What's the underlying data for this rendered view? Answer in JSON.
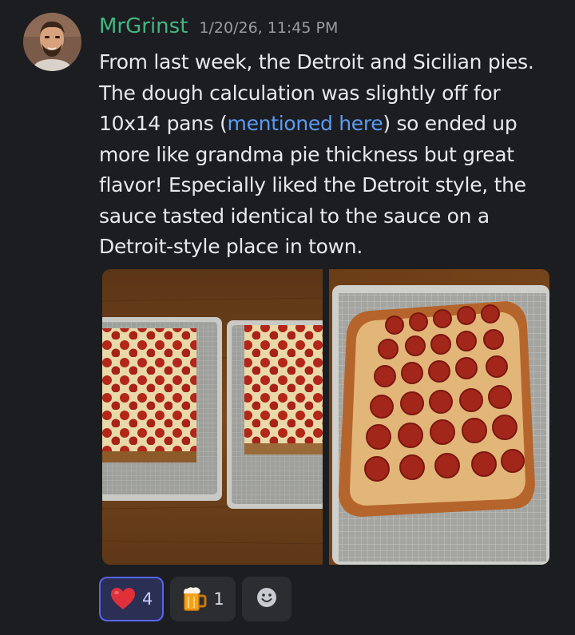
{
  "message": {
    "username": "MrGrinst",
    "timestamp": "1/20/26, 11:45 PM",
    "avatar": "user-avatar",
    "username_color": "#43b581",
    "link_color": "#5b9bf3",
    "body": {
      "l1": "From last week, the Detroit and Sicilian pies.",
      "l2": "The dough calculation was slightly off for",
      "l3_pre": "10x14 pans (",
      "l3_link": "mentioned here",
      "l3_post": ") so ended up",
      "l4": "more like grandma pie thickness but great",
      "l5": "flavor! Especially liked the Detroit style, the",
      "l6": "sauce tasted identical to the sauce on a",
      "l7": "Detroit-style place in town."
    },
    "attachments": [
      {
        "name": "two-pizzas-on-trays-photo"
      },
      {
        "name": "detroit-pizza-closeup-photo"
      }
    ]
  },
  "reactions": [
    {
      "emoji": "heart-emoji",
      "count": "4",
      "active": true
    },
    {
      "emoji": "beer-mug-emoji",
      "count": "1",
      "active": false
    }
  ],
  "add_reaction_icon": "smiley-add-reaction-icon",
  "colors": {
    "background": "#1c1d21",
    "reaction_active_border": "#5865f2"
  }
}
